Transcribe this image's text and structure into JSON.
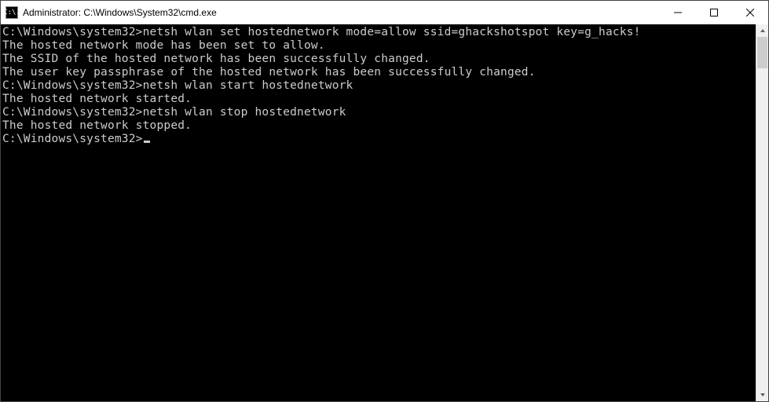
{
  "window": {
    "title": "Administrator: C:\\Windows\\System32\\cmd.exe",
    "app_icon_text": "C:\\."
  },
  "terminal": {
    "prompt": "C:\\Windows\\system32>",
    "lines": [
      {
        "prompt": "C:\\Windows\\system32>",
        "cmd": "netsh wlan set hostednetwork mode=allow ssid=ghackshotspot key=g_hacks!"
      },
      {
        "out": "The hosted network mode has been set to allow."
      },
      {
        "out": "The SSID of the hosted network has been successfully changed."
      },
      {
        "out": "The user key passphrase of the hosted network has been successfully changed."
      },
      {
        "out": ""
      },
      {
        "out": ""
      },
      {
        "prompt": "C:\\Windows\\system32>",
        "cmd": "netsh wlan start hostednetwork"
      },
      {
        "out": "The hosted network started."
      },
      {
        "out": ""
      },
      {
        "out": ""
      },
      {
        "prompt": "C:\\Windows\\system32>",
        "cmd": "netsh wlan stop hostednetwork"
      },
      {
        "out": "The hosted network stopped."
      },
      {
        "out": ""
      },
      {
        "out": ""
      },
      {
        "prompt": "C:\\Windows\\system32>",
        "cursor": true
      }
    ]
  }
}
